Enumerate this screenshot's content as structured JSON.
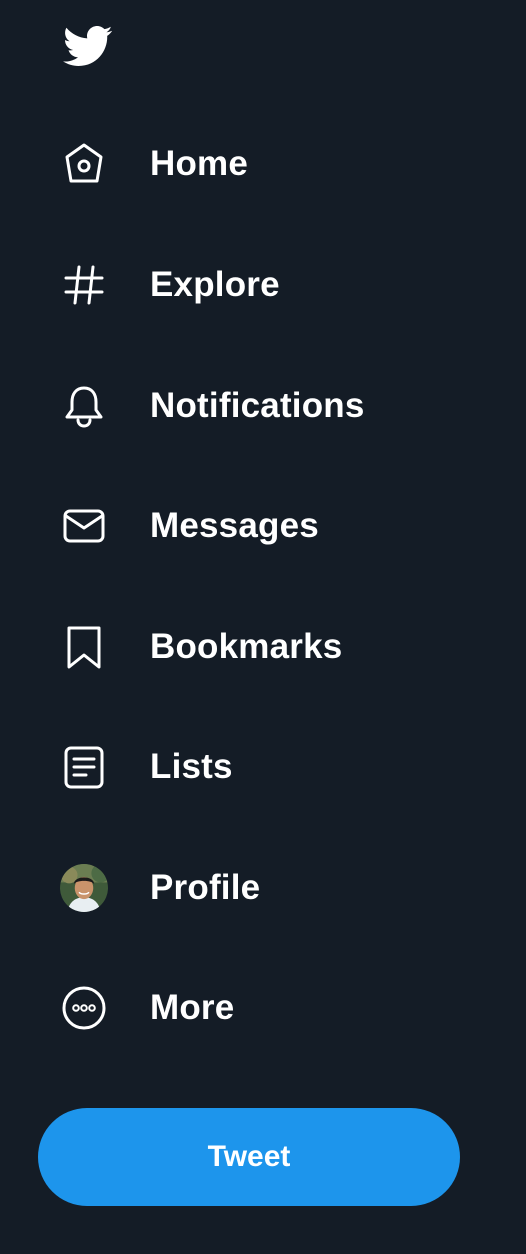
{
  "logo": {
    "icon": "twitter-bird-icon",
    "color": "#ffffff"
  },
  "nav": {
    "items": [
      {
        "label": "Home",
        "icon": "home-icon"
      },
      {
        "label": "Explore",
        "icon": "hashtag-icon"
      },
      {
        "label": "Notifications",
        "icon": "bell-icon"
      },
      {
        "label": "Messages",
        "icon": "envelope-icon"
      },
      {
        "label": "Bookmarks",
        "icon": "bookmark-icon"
      },
      {
        "label": "Lists",
        "icon": "list-document-icon"
      },
      {
        "label": "Profile",
        "icon": "avatar"
      },
      {
        "label": "More",
        "icon": "more-circle-icon"
      }
    ]
  },
  "tweet_button": {
    "label": "Tweet",
    "color": "#1d95ec"
  },
  "colors": {
    "background": "#141c26",
    "text": "#ffffff",
    "accent": "#1d95ec"
  }
}
